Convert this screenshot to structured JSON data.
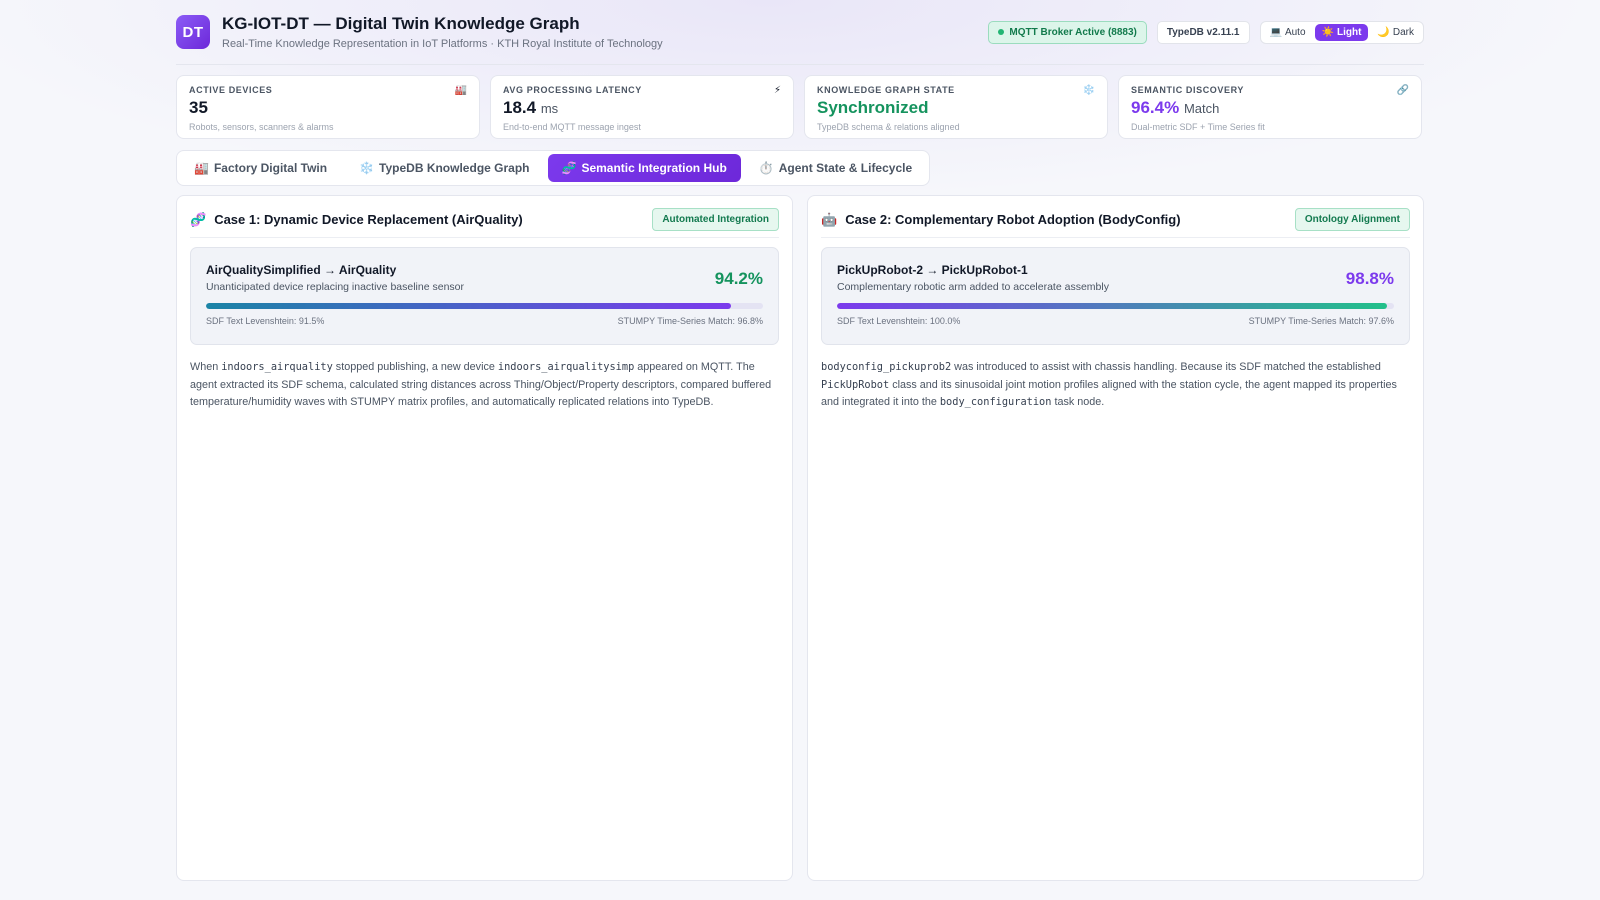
{
  "header": {
    "logo_text": "DT",
    "title": "KG-IOT-DT — Digital Twin Knowledge Graph",
    "subtitle": "Real-Time Knowledge Representation in IoT Platforms · KTH Royal Institute of Technology",
    "mqtt_status": "MQTT Broker Active (8883)",
    "typedb_version": "TypeDB v2.11.1",
    "theme": {
      "auto": "Auto",
      "light": "Light",
      "dark": "Dark",
      "selected": "Light"
    }
  },
  "stats": [
    {
      "label": "ACTIVE DEVICES",
      "icon": "factory-icon",
      "value": "35",
      "unit": "",
      "desc": "Robots, sensors, scanners & alarms"
    },
    {
      "label": "AVG PROCESSING LATENCY",
      "icon": "lightning-icon",
      "value": "18.4",
      "unit": "ms",
      "desc": "End-to-end MQTT message ingest"
    },
    {
      "label": "KNOWLEDGE GRAPH STATE",
      "icon": "snowflake-icon",
      "value": "Synchronized",
      "unit": "",
      "desc": "TypeDB schema & relations aligned"
    },
    {
      "label": "SEMANTIC DISCOVERY",
      "icon": "link-icon",
      "value": "96.4%",
      "unit": "Match",
      "desc": "Dual-metric SDF + Time Series fit"
    }
  ],
  "tabs": [
    {
      "label": "Factory Digital Twin",
      "icon": "factory-icon"
    },
    {
      "label": "TypeDB Knowledge Graph",
      "icon": "snowflake-icon"
    },
    {
      "label": "Semantic Integration Hub",
      "icon": "dna-icon",
      "active": true
    },
    {
      "label": "Agent State & Lifecycle",
      "icon": "stopwatch-icon"
    }
  ],
  "cases": [
    {
      "icon": "dna-icon",
      "title": "Case 1: Dynamic Device Replacement (AirQuality)",
      "badge": "Automated Integration",
      "match_title": "AirQualitySimplified → AirQuality",
      "match_sub": "Unanticipated device replacing inactive baseline sensor",
      "score": "94.2%",
      "score_fraction": 0.942,
      "sdf_label": "SDF Text Levenshtein: 91.5%",
      "stumpy_label": "STUMPY Time-Series Match: 96.8%",
      "text": {
        "t1": "When ",
        "c1": "indoors_airquality",
        "t2": " stopped publishing, a new device ",
        "c2": "indoors_airqualitysimp",
        "t3": " appeared on MQTT. The agent extracted its SDF schema, calculated string distances across Thing/Object/Property descriptors, compared buffered temperature/humidity waves with STUMPY matrix profiles, and automatically replicated relations into TypeDB."
      }
    },
    {
      "icon": "robot-icon",
      "title": "Case 2: Complementary Robot Adoption (BodyConfig)",
      "badge": "Ontology Alignment",
      "match_title": "PickUpRobot-2 → PickUpRobot-1",
      "match_sub": "Complementary robotic arm added to accelerate assembly",
      "score": "98.8%",
      "score_fraction": 0.988,
      "sdf_label": "SDF Text Levenshtein: 100.0%",
      "stumpy_label": "STUMPY Time-Series Match: 97.6%",
      "text": {
        "c1": "bodyconfig_pickuprob2",
        "t1": " was introduced to assist with chassis handling. Because its SDF matched the established ",
        "c2": "PickUpRobot",
        "t2": " class and its sinusoidal joint motion profiles aligned with the station cycle, the agent mapped its properties and integrated it into the ",
        "c3": "body_configuration",
        "t3": " task node."
      }
    }
  ],
  "colors": {
    "accent": "#7c3aed",
    "success": "#15935e",
    "background": "#f6f7fb"
  }
}
